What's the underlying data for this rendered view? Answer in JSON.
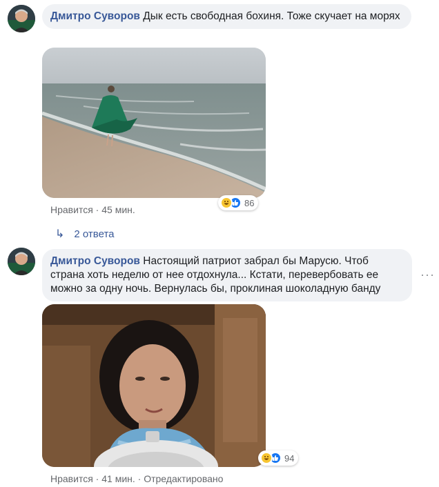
{
  "comments": [
    {
      "author": "Дмитро Суворов",
      "text": "Дык есть свободная бохиня. Тоже скучает на морях",
      "like_label": "Нравится",
      "separator": "·",
      "time": "45 мин.",
      "reaction_count": "86",
      "replies_label": "2 ответа",
      "photo_icon": "beach-woman-green-dress"
    },
    {
      "author": "Дмитро Суворов",
      "text": "Настоящий патриот забрал бы Марусю. Чтоб страна хоть неделю от нее отдохнула... Кстати, перевербовать ее можно за одну ночь. Вернулась бы, проклиная шоколадную банду",
      "like_label": "Нравится",
      "separator": "·",
      "time": "41 мин.",
      "edited": "Отредактировано",
      "reaction_count": "94",
      "more_icon": "more-horizontal-icon",
      "photo_icon": "woman-megaphone"
    }
  ],
  "colors": {
    "author": "#385898",
    "bubble": "#f0f2f5",
    "meta": "#65676b",
    "like_reaction": "#1877f2",
    "haha_reaction": "#f7c531"
  }
}
